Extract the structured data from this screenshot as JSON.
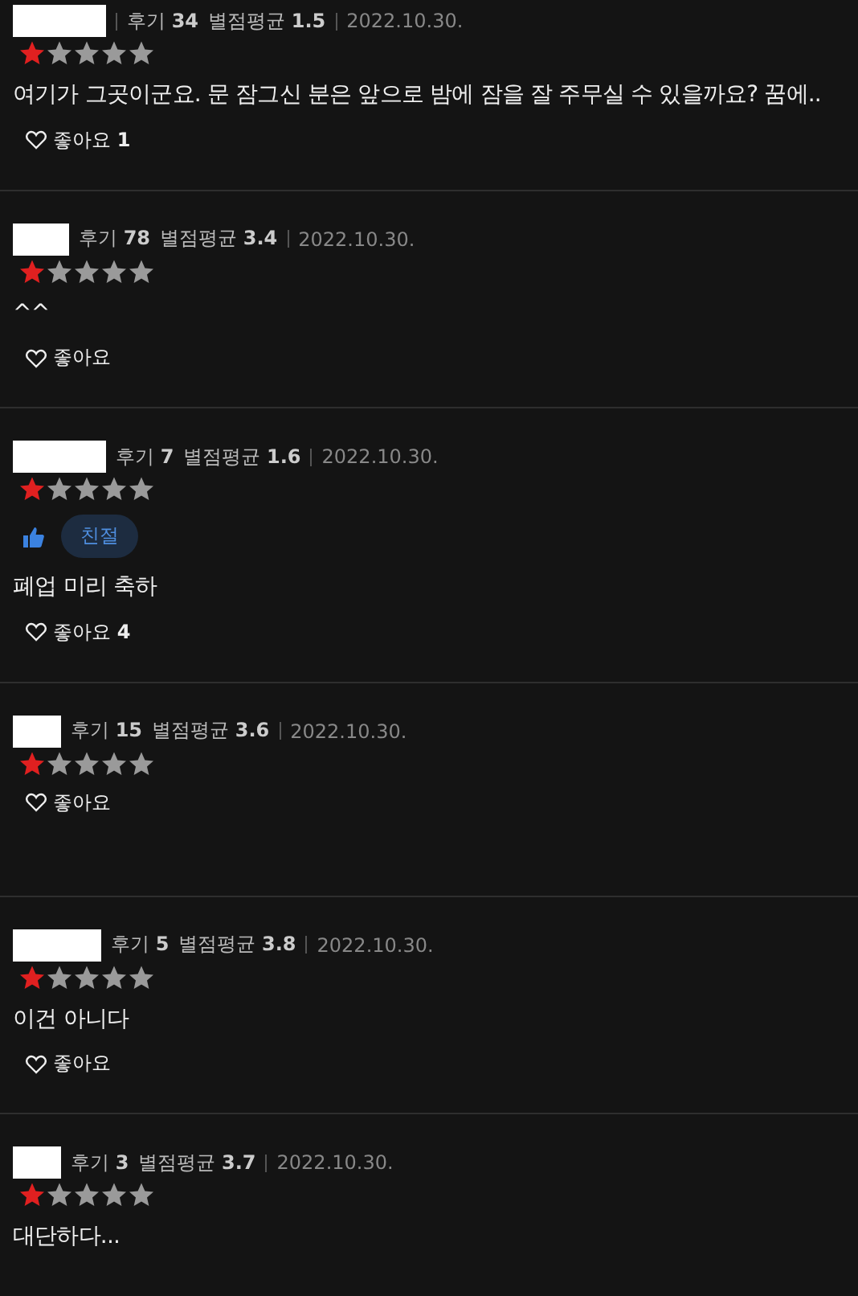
{
  "reviews": [
    {
      "review_label": "후기",
      "review_count": "34",
      "avg_label": "별점평균",
      "avg": "1.5",
      "date": "2022.10.30.",
      "stars": 1,
      "text": "여기가 그곳이군요. 문 잠그신 분은 앞으로 밤에 잠을 잘 주무실 수 있을까요? 꿈에..",
      "like_label": "좋아요",
      "like_count": "1"
    },
    {
      "review_label": "후기",
      "review_count": "78",
      "avg_label": "별점평균",
      "avg": "3.4",
      "date": "2022.10.30.",
      "stars": 1,
      "text": "^^",
      "like_label": "좋아요"
    },
    {
      "review_label": "후기",
      "review_count": "7",
      "avg_label": "별점평균",
      "avg": "1.6",
      "date": "2022.10.30.",
      "stars": 1,
      "badge": "친절",
      "text": "폐업 미리 축하",
      "like_label": "좋아요",
      "like_count": "4"
    },
    {
      "review_label": "후기",
      "review_count": "15",
      "avg_label": "별점평균",
      "avg": "3.6",
      "date": "2022.10.30.",
      "stars": 1,
      "like_label": "좋아요"
    },
    {
      "review_label": "후기",
      "review_count": "5",
      "avg_label": "별점평균",
      "avg": "3.8",
      "date": "2022.10.30.",
      "stars": 1,
      "text": "이건 아니다",
      "like_label": "좋아요"
    },
    {
      "review_label": "후기",
      "review_count": "3",
      "avg_label": "별점평균",
      "avg": "3.7",
      "date": "2022.10.30.",
      "stars": 1,
      "text": "대단하다..."
    }
  ]
}
